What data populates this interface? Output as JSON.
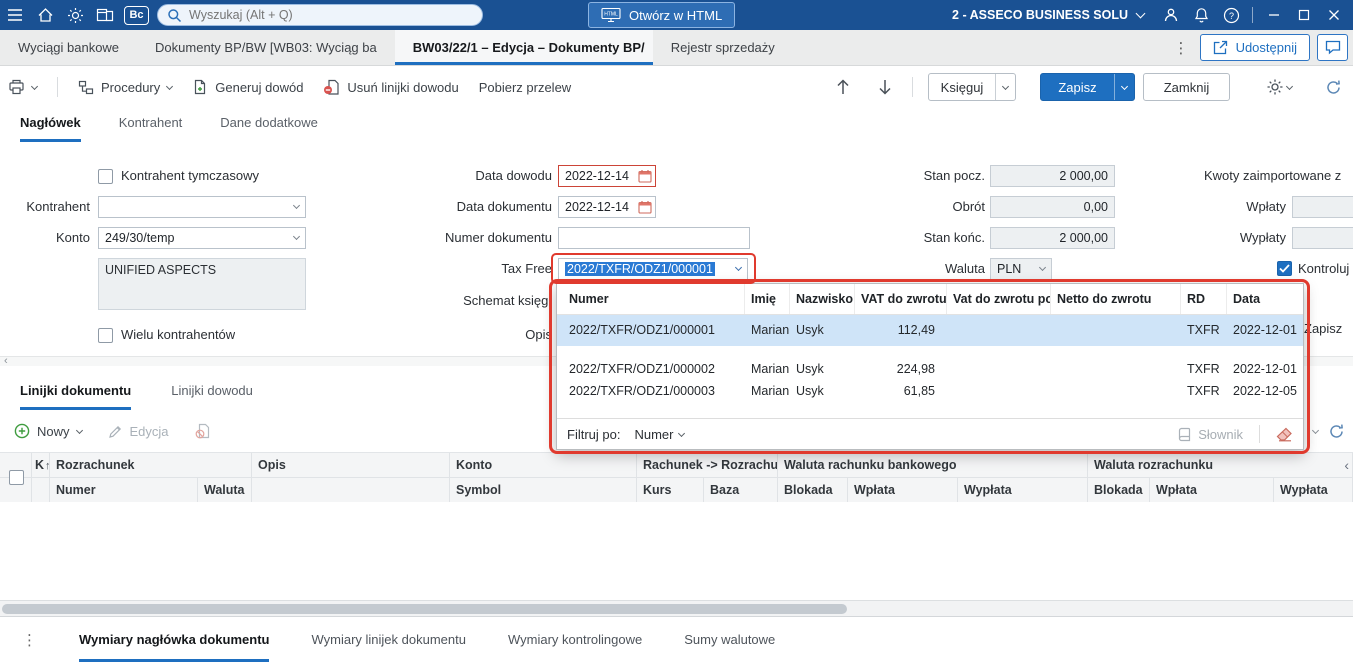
{
  "colors": {
    "topbar": "#1a5193",
    "accent": "#1e6fc0",
    "annotation": "#e03a2e",
    "selected_row": "#cfe4f8"
  },
  "icons": {
    "html_label": "HTML",
    "question_mark": "?",
    "bc_badge": "Bc",
    "more_dots": "⋮",
    "sort_asc": "↑",
    "scroll_left": "‹",
    "collapse_left": "‹"
  },
  "topbar": {
    "search_placeholder": "Wyszukaj (Alt + Q)",
    "open_html": "Otwórz w HTML",
    "company": "2 - ASSECO BUSINESS SOLU"
  },
  "doc_tabs": {
    "tab1": "Wyciągi bankowe",
    "tab2": "Dokumenty BP/BW [WB03: Wyciąg ba",
    "tab3": "BW03/22/1 – Edycja – Dokumenty BP/",
    "tab4": "Rejestr sprzedaży",
    "share": "Udostępnij"
  },
  "toolbar": {
    "procedury": "Procedury",
    "generuj_dowod": "Generuj dowód",
    "usun_linijki": "Usuń linijki dowodu",
    "pobierz_przelew": "Pobierz przelew",
    "ksieguj": "Księguj",
    "zapisz": "Zapisz",
    "zamknij": "Zamknij"
  },
  "form_tabs": {
    "naglowek": "Nagłówek",
    "kontrahent": "Kontrahent",
    "dane_dodatkowe": "Dane dodatkowe"
  },
  "form": {
    "kontrahent_tymczasowy": "Kontrahent tymczasowy",
    "kontrahent": "Kontrahent",
    "konto": "Konto",
    "konto_value": "249/30/temp",
    "kontrahent_name": "UNIFIED ASPECTS",
    "wielu_kontrahentow": "Wielu kontrahentów",
    "data_dowodu": "Data dowodu",
    "data_dowodu_value": "2022-12-14",
    "data_dokumentu": "Data dokumentu",
    "data_dokumentu_value": "2022-12-14",
    "numer_dokumentu": "Numer dokumentu",
    "tax_free": "Tax Free",
    "tax_free_value": "2022/TXFR/ODZ1/000001",
    "schemat_ksieg": "Schemat księg.",
    "opis": "Opis",
    "stan_pocz": "Stan pocz.",
    "stan_pocz_value": "2 000,00",
    "obrot": "Obrót",
    "obrot_value": "0,00",
    "stan_konc": "Stan końc.",
    "stan_konc_value": "2 000,00",
    "waluta": "Waluta",
    "waluta_value": "PLN",
    "kwoty_zaimportowane": "Kwoty zaimportowane z",
    "wplaty": "Wpłaty",
    "wyplaty": "Wypłaty",
    "kontroluj": "Kontroluj",
    "zapisz_hidden": "Zapisz"
  },
  "popup": {
    "columns": {
      "numer": "Numer",
      "imie": "Imię",
      "nazwisko": "Nazwisko",
      "vat_do_zwrotu": "VAT do zwrotu",
      "vat_do_zwrotu_pot": "Vat do  zwrotu pot",
      "netto_do_zwrotu": "Netto do zwrotu",
      "rd": "RD",
      "data": "Data"
    },
    "rows": [
      {
        "numer": "2022/TXFR/ODZ1/000001",
        "imie": "Marian",
        "nazwisko": "Usyk",
        "vat": "112,49",
        "rd": "TXFR",
        "data": "2022-12-01"
      },
      {
        "numer": "2022/TXFR/ODZ1/000002",
        "imie": "Marian",
        "nazwisko": "Usyk",
        "vat": "224,98",
        "rd": "TXFR",
        "data": "2022-12-01"
      },
      {
        "numer": "2022/TXFR/ODZ1/000003",
        "imie": "Marian",
        "nazwisko": "Usyk",
        "vat": "61,85",
        "rd": "TXFR",
        "data": "2022-12-05"
      }
    ],
    "filtruj_po": "Filtruj po:",
    "filtruj_value": "Numer",
    "slownik": "Słownik"
  },
  "lines": {
    "tab_dokumentu": "Linijki dokumentu",
    "tab_dowodu": "Linijki dowodu",
    "nowy": "Nowy",
    "edycja": "Edycja",
    "header1": {
      "k": "K",
      "rozrachunek": "Rozrachunek",
      "opis": "Opis",
      "konto": "Konto",
      "rachunek": "Rachunek -> Rozrachu",
      "waluta_rachunku": "Waluta rachunku bankowego",
      "waluta_rozrachunku": "Waluta rozrachunku"
    },
    "header2": {
      "numer": "Numer",
      "waluta": "Waluta",
      "symbol": "Symbol",
      "kurs": "Kurs",
      "baza": "Baza",
      "blokada1": "Blokada",
      "wplata1": "Wpłata",
      "wyplata1": "Wypłata",
      "blokada2": "Blokada",
      "wplata2": "Wpłata",
      "wyplata2": "Wypłata"
    }
  },
  "bottom_tabs": {
    "t1": "Wymiary nagłówka dokumentu",
    "t2": "Wymiary linijek dokumentu",
    "t3": "Wymiary kontrolingowe",
    "t4": "Sumy walutowe"
  }
}
